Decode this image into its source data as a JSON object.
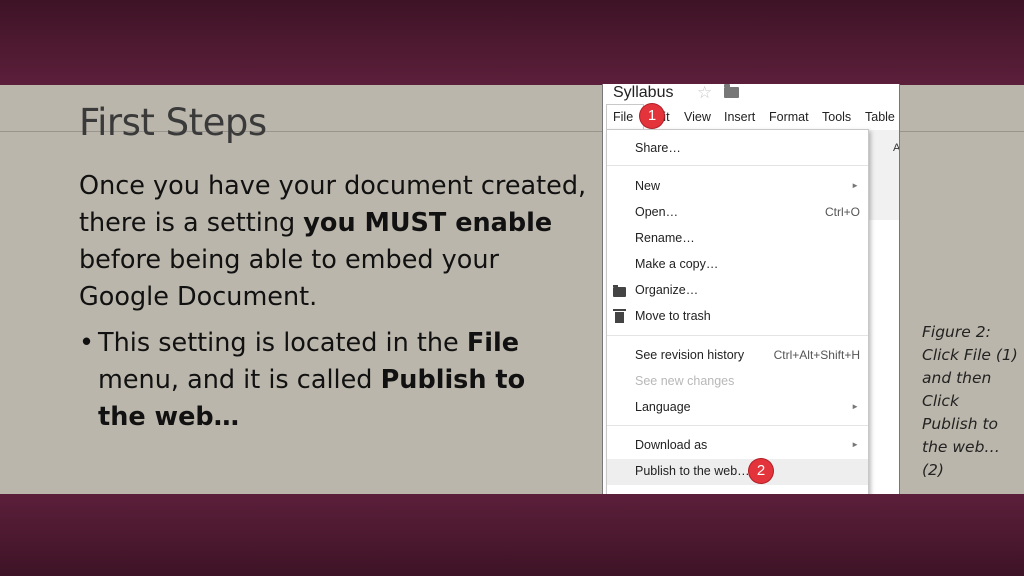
{
  "slide": {
    "title": "First Steps",
    "body": {
      "part1": "Once you have your document created, there is a setting ",
      "bold1": "you MUST enable",
      "part2": " before being able to embed your Google Document."
    },
    "bullet": {
      "marker": "•",
      "part1": "This setting is located in the ",
      "bold1": "File",
      "part2": " menu, and it is called ",
      "bold2": "Publish to the web…"
    },
    "caption": "Figure 2: Click File (1) and then Click Publish to the web… (2)"
  },
  "screenshot": {
    "doc_title": "Syllabus",
    "star_icon": "☆",
    "menubar": {
      "file": "File",
      "edit": "Edit",
      "view": "View",
      "insert": "Insert",
      "format": "Format",
      "tools": "Tools",
      "table": "Table"
    },
    "toolbar_partial": "A",
    "badges": {
      "one": "1",
      "two": "2"
    },
    "menu_items": {
      "share": "Share…",
      "new": "New",
      "open": "Open…",
      "open_shortcut": "Ctrl+O",
      "rename": "Rename…",
      "make_copy": "Make a copy…",
      "organize": "Organize…",
      "move_trash": "Move to trash",
      "revision_history": "See revision history",
      "revision_shortcut": "Ctrl+Alt+Shift+H",
      "new_changes": "See new changes",
      "language": "Language",
      "download_as": "Download as",
      "publish": "Publish to the web…",
      "submenu_arrow": "►"
    }
  },
  "colors": {
    "band": "#5c1f3b",
    "slide_bg": "#bbb6ab",
    "badge": "#e3343c",
    "highlight": "#eeeeee"
  }
}
